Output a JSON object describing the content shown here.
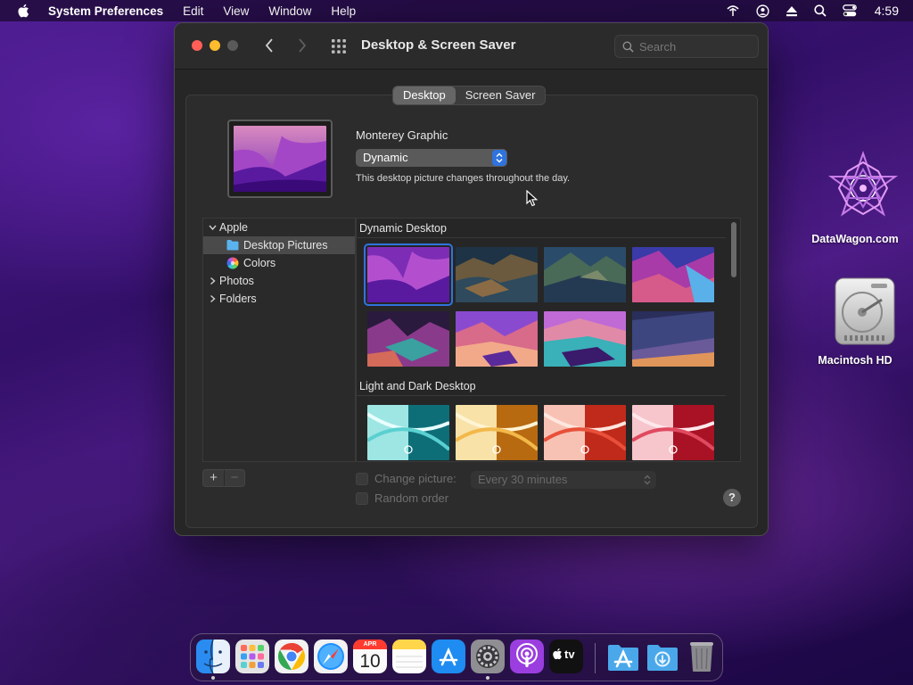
{
  "menubar": {
    "app_name": "System Preferences",
    "items": [
      "Edit",
      "View",
      "Window",
      "Help"
    ],
    "clock": "4:59",
    "status_icons": [
      "wifi-icon",
      "user-icon",
      "eject-icon",
      "search-icon",
      "control-center-icon"
    ]
  },
  "desktop_icons": [
    {
      "label": "DataWagon.com",
      "icon": "datawagon-logo-icon"
    },
    {
      "label": "Macintosh HD",
      "icon": "hard-drive-icon"
    }
  ],
  "window": {
    "title": "Desktop & Screen Saver",
    "search_placeholder": "Search",
    "tabs": [
      {
        "label": "Desktop",
        "active": true
      },
      {
        "label": "Screen Saver",
        "active": false
      }
    ],
    "wallpaper_name": "Monterey Graphic",
    "mode_value": "Dynamic",
    "mode_description": "This desktop picture changes throughout the day.",
    "sidebar": {
      "group": "Apple",
      "items": [
        {
          "label": "Desktop Pictures",
          "icon": "folder-icon",
          "selected": true
        },
        {
          "label": "Colors",
          "icon": "color-wheel-icon",
          "selected": false
        }
      ],
      "collapsed_groups": [
        "Photos",
        "Folders"
      ]
    },
    "sections": [
      {
        "title": "Dynamic Desktop",
        "count": 8,
        "selected_index": 0
      },
      {
        "title": "Light and Dark Desktop",
        "count": 4
      }
    ],
    "change_picture_label": "Change picture:",
    "change_interval": "Every 30 minutes",
    "random_order_label": "Random order",
    "plus_label": "+",
    "minus_label": "−",
    "help_label": "?",
    "accent_color": "#2f73dd"
  },
  "dock": {
    "apps": [
      {
        "name": "Finder",
        "icon": "finder-icon",
        "running": true
      },
      {
        "name": "Launchpad",
        "icon": "launchpad-icon",
        "running": false
      },
      {
        "name": "Chrome",
        "icon": "chrome-icon",
        "running": false
      },
      {
        "name": "Safari",
        "icon": "safari-icon",
        "running": false
      },
      {
        "name": "Calendar",
        "icon": "calendar-icon",
        "running": false,
        "month": "APR",
        "day": "10"
      },
      {
        "name": "Notes",
        "icon": "notes-icon",
        "running": false
      },
      {
        "name": "App Store",
        "icon": "app-store-icon",
        "running": false
      },
      {
        "name": "System Preferences",
        "icon": "system-preferences-icon",
        "running": true
      },
      {
        "name": "Podcasts",
        "icon": "podcasts-icon",
        "running": false
      },
      {
        "name": "TV",
        "icon": "apple-tv-icon",
        "running": false,
        "label": "tv"
      },
      {
        "name": "Applications",
        "icon": "applications-folder-icon",
        "running": false
      },
      {
        "name": "Downloads",
        "icon": "downloads-folder-icon",
        "running": false
      },
      {
        "name": "Trash",
        "icon": "trash-icon",
        "running": false
      }
    ]
  }
}
